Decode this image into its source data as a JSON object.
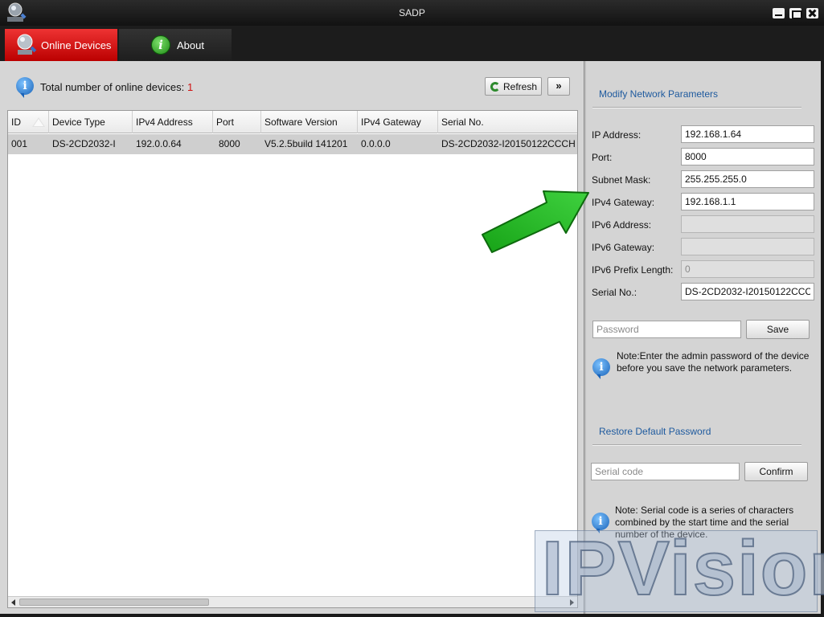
{
  "window": {
    "title": "SADP"
  },
  "tabs": [
    {
      "label": "Online Devices",
      "active": true
    },
    {
      "label": "About",
      "active": false
    }
  ],
  "summary": {
    "label": "Total number of online devices:",
    "count": "1"
  },
  "toolbar": {
    "refresh_label": "Refresh",
    "more_label": "»"
  },
  "table": {
    "columns": [
      "ID",
      "Device Type",
      "IPv4 Address",
      "Port",
      "Software Version",
      "IPv4 Gateway",
      "Serial No."
    ],
    "rows": [
      [
        "001",
        "DS-2CD2032-I",
        "192.0.0.64",
        "8000",
        "V5.2.5build 141201",
        "0.0.0.0",
        "DS-2CD2032-I20150122CCCH"
      ]
    ]
  },
  "modify": {
    "title": "Modify Network Parameters",
    "fields": [
      {
        "label": "IP Address:",
        "value": "192.168.1.64",
        "enabled": true
      },
      {
        "label": "Port:",
        "value": "8000",
        "enabled": true
      },
      {
        "label": "Subnet Mask:",
        "value": "255.255.255.0",
        "enabled": true
      },
      {
        "label": "IPv4 Gateway:",
        "value": "192.168.1.1",
        "enabled": true
      },
      {
        "label": "IPv6 Address:",
        "value": "",
        "enabled": false
      },
      {
        "label": "IPv6 Gateway:",
        "value": "",
        "enabled": false
      },
      {
        "label": "IPv6 Prefix Length:",
        "value": "0",
        "enabled": false
      },
      {
        "label": "Serial No.:",
        "value": "DS-2CD2032-I20150122CCC",
        "enabled": true
      }
    ],
    "password_placeholder": "Password",
    "save_label": "Save",
    "note": "Note:Enter the admin password of the device before you save the network parameters."
  },
  "restore": {
    "title": "Restore Default Password",
    "serial_placeholder": "Serial code",
    "confirm_label": "Confirm",
    "note": "Note: Serial code is a series of characters combined by the start time and the serial number of the device."
  },
  "watermark": {
    "text": "IPVision"
  },
  "colors": {
    "accent_tab": "#cc1111",
    "section_title": "#1e5a9e",
    "count": "#d01010",
    "arrow": "#22aa22"
  },
  "icons": [
    "app-logo-icon",
    "online-devices-icon",
    "about-info-icon",
    "info-icon",
    "refresh-icon",
    "sort-triangle-icon",
    "green-arrow-icon"
  ]
}
